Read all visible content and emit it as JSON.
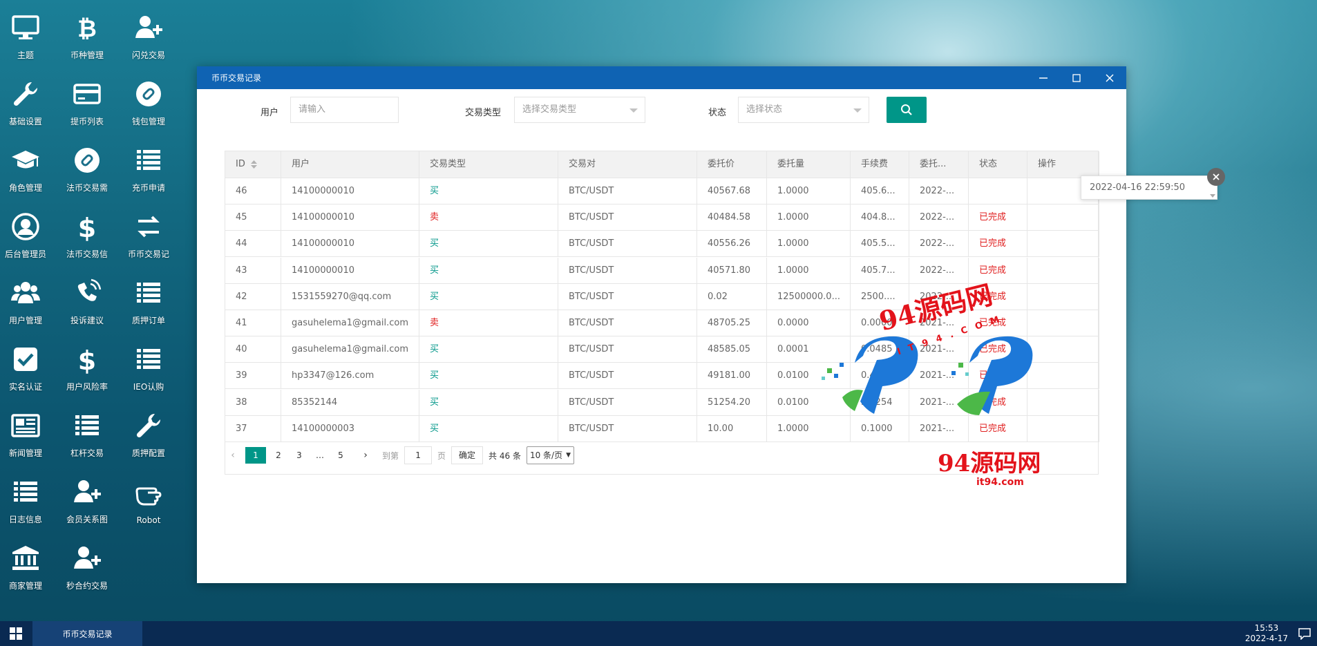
{
  "desktop": {
    "icons": [
      {
        "label": "主题",
        "icon": "monitor-icon"
      },
      {
        "label": "币种管理",
        "icon": "bitcoin-icon"
      },
      {
        "label": "闪兑交易",
        "icon": "user-plus-icon"
      },
      {
        "label": "基础设置",
        "icon": "wrench-icon"
      },
      {
        "label": "提币列表",
        "icon": "credit-card-icon"
      },
      {
        "label": "钱包管理",
        "icon": "link-circle-icon"
      },
      {
        "label": "角色管理",
        "icon": "graduation-cap-icon"
      },
      {
        "label": "法币交易需",
        "icon": "link-circle-icon"
      },
      {
        "label": "充币申请",
        "icon": "list-icon"
      },
      {
        "label": "后台管理员",
        "icon": "user-circle-icon"
      },
      {
        "label": "法币交易信",
        "icon": "dollar-icon"
      },
      {
        "label": "币币交易记",
        "icon": "exchange-icon"
      },
      {
        "label": "用户管理",
        "icon": "users-icon"
      },
      {
        "label": "投诉建议",
        "icon": "phone-icon"
      },
      {
        "label": "质押订单",
        "icon": "list-icon"
      },
      {
        "label": "实名认证",
        "icon": "checkbox-icon"
      },
      {
        "label": "用户风险率",
        "icon": "dollar-icon"
      },
      {
        "label": "IEO认购",
        "icon": "list-icon"
      },
      {
        "label": "新闻管理",
        "icon": "newspaper-icon"
      },
      {
        "label": "杠杆交易",
        "icon": "list-icon"
      },
      {
        "label": "质押配置",
        "icon": "wrench-icon"
      },
      {
        "label": "日志信息",
        "icon": "list-icon"
      },
      {
        "label": "会员关系图",
        "icon": "user-plus-icon"
      },
      {
        "label": "Robot",
        "icon": "hand-icon"
      },
      {
        "label": "商家管理",
        "icon": "bank-icon"
      },
      {
        "label": "秒合约交易",
        "icon": "user-plus-icon"
      }
    ]
  },
  "window": {
    "title": "币币交易记录",
    "filters": {
      "user_label": "用户",
      "user_placeholder": "请输入",
      "type_label": "交易类型",
      "type_placeholder": "选择交易类型",
      "status_label": "状态",
      "status_placeholder": "选择状态"
    },
    "table": {
      "headers": [
        "ID",
        "用户",
        "交易类型",
        "交易对",
        "委托价",
        "委托量",
        "手续费",
        "委托...",
        "状态",
        "操作"
      ],
      "rows": [
        {
          "id": "46",
          "user": "14100000010",
          "type": "买",
          "pair": "BTC/USDT",
          "price": "40567.68",
          "amount": "1.0000",
          "fee": "405.6...",
          "time": "2022-...",
          "status": ""
        },
        {
          "id": "45",
          "user": "14100000010",
          "type": "卖",
          "pair": "BTC/USDT",
          "price": "40484.58",
          "amount": "1.0000",
          "fee": "404.8...",
          "time": "2022-...",
          "status": "已完成"
        },
        {
          "id": "44",
          "user": "14100000010",
          "type": "买",
          "pair": "BTC/USDT",
          "price": "40556.26",
          "amount": "1.0000",
          "fee": "405.5...",
          "time": "2022-...",
          "status": "已完成"
        },
        {
          "id": "43",
          "user": "14100000010",
          "type": "买",
          "pair": "BTC/USDT",
          "price": "40571.80",
          "amount": "1.0000",
          "fee": "405.7...",
          "time": "2022-...",
          "status": "已完成"
        },
        {
          "id": "42",
          "user": "1531559270@qq.com",
          "type": "买",
          "pair": "BTC/USDT",
          "price": "0.02",
          "amount": "12500000.0...",
          "fee": "2500....",
          "time": "2022-...",
          "status": "已完成"
        },
        {
          "id": "41",
          "user": "gasuhelema1@gmail.com",
          "type": "卖",
          "pair": "BTC/USDT",
          "price": "48705.25",
          "amount": "0.0000",
          "fee": "0.0000",
          "time": "2021-...",
          "status": "已完成"
        },
        {
          "id": "40",
          "user": "gasuhelema1@gmail.com",
          "type": "买",
          "pair": "BTC/USDT",
          "price": "48585.05",
          "amount": "0.0001",
          "fee": "0.0485",
          "time": "2021-...",
          "status": "已完成"
        },
        {
          "id": "39",
          "user": "hp3347@126.com",
          "type": "买",
          "pair": "BTC/USDT",
          "price": "49181.00",
          "amount": "0.0100",
          "fee": "0.4918",
          "time": "2021-...",
          "status": "已完成"
        },
        {
          "id": "38",
          "user": "85352144",
          "type": "买",
          "pair": "BTC/USDT",
          "price": "51254.20",
          "amount": "0.0100",
          "fee": "5.1254",
          "time": "2021-...",
          "status": "已完成"
        },
        {
          "id": "37",
          "user": "14100000003",
          "type": "买",
          "pair": "BTC/USDT",
          "price": "10.00",
          "amount": "1.0000",
          "fee": "0.1000",
          "time": "2021-...",
          "status": "已完成"
        }
      ]
    },
    "tooltip": "2022-04-16 22:59:50",
    "pagination": {
      "pages": [
        "1",
        "2",
        "3",
        "…",
        "5"
      ],
      "goto_label": "到第",
      "goto_value": "1",
      "page_unit": "页",
      "confirm": "确定",
      "total": "共 46 条",
      "page_size": "10 条/页"
    }
  },
  "watermark": {
    "text": "94源码网",
    "sub": "IT94.COM",
    "url": "it94.com"
  },
  "taskbar": {
    "task": "币币交易记录",
    "time": "15:53",
    "date": "2022-4-17"
  },
  "colors": {
    "titlebar": "#0f63b3",
    "accent": "#009688",
    "sell": "#e02020",
    "taskbar": "#0a2a52"
  }
}
